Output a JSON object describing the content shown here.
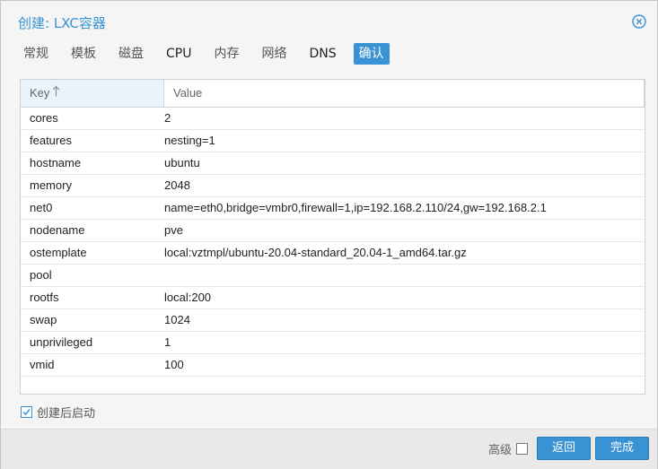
{
  "window": {
    "title": "创建: LXC容器",
    "close_icon": "close-circle-icon"
  },
  "tabs": [
    {
      "label": "常规",
      "active": false
    },
    {
      "label": "模板",
      "active": false
    },
    {
      "label": "磁盘",
      "active": false
    },
    {
      "label": "CPU",
      "active": false
    },
    {
      "label": "内存",
      "active": false
    },
    {
      "label": "网络",
      "active": false
    },
    {
      "label": "DNS",
      "active": false
    },
    {
      "label": "确认",
      "active": true
    }
  ],
  "grid": {
    "columns": {
      "key": "Key",
      "value": "Value"
    },
    "sort_icon": "sort-ascending-icon",
    "rows": [
      {
        "key": "cores",
        "value": "2"
      },
      {
        "key": "features",
        "value": "nesting=1"
      },
      {
        "key": "hostname",
        "value": "ubuntu"
      },
      {
        "key": "memory",
        "value": "2048"
      },
      {
        "key": "net0",
        "value": "name=eth0,bridge=vmbr0,firewall=1,ip=192.168.2.110/24,gw=192.168.2.1"
      },
      {
        "key": "nodename",
        "value": "pve"
      },
      {
        "key": "ostemplate",
        "value": "local:vztmpl/ubuntu-20.04-standard_20.04-1_amd64.tar.gz"
      },
      {
        "key": "pool",
        "value": ""
      },
      {
        "key": "rootfs",
        "value": "local:200"
      },
      {
        "key": "swap",
        "value": "1024"
      },
      {
        "key": "unprivileged",
        "value": "1"
      },
      {
        "key": "vmid",
        "value": "100"
      }
    ]
  },
  "start_after_created": {
    "label": "创建后启动",
    "checked": true
  },
  "footer": {
    "advanced_label": "高级",
    "advanced_checked": false,
    "back_label": "返回",
    "finish_label": "完成"
  },
  "colors": {
    "accent": "#3892d4",
    "header_key_bg": "#eaf2fb",
    "footer_bg": "#e9e9e9"
  }
}
